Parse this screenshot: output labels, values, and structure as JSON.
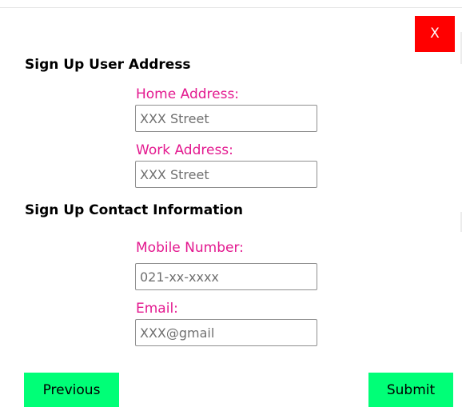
{
  "dialog": {
    "close_label": "X"
  },
  "address_section": {
    "title": "Sign Up User Address",
    "home_label": "Home Address:",
    "home_placeholder": "XXX Street",
    "work_label": "Work Address:",
    "work_placeholder": "XXX Street"
  },
  "contact_section": {
    "title": "Sign Up Contact Information",
    "mobile_label": "Mobile Number:",
    "mobile_placeholder": "021-xx-xxxx",
    "email_label": "Email:",
    "email_placeholder": "XXX@gmail"
  },
  "footer": {
    "previous_label": "Previous",
    "submit_label": "Submit"
  },
  "colors": {
    "close_button_bg": "#ff0000",
    "label_color": "#e3198f",
    "nav_button_bg": "#00ff77"
  }
}
